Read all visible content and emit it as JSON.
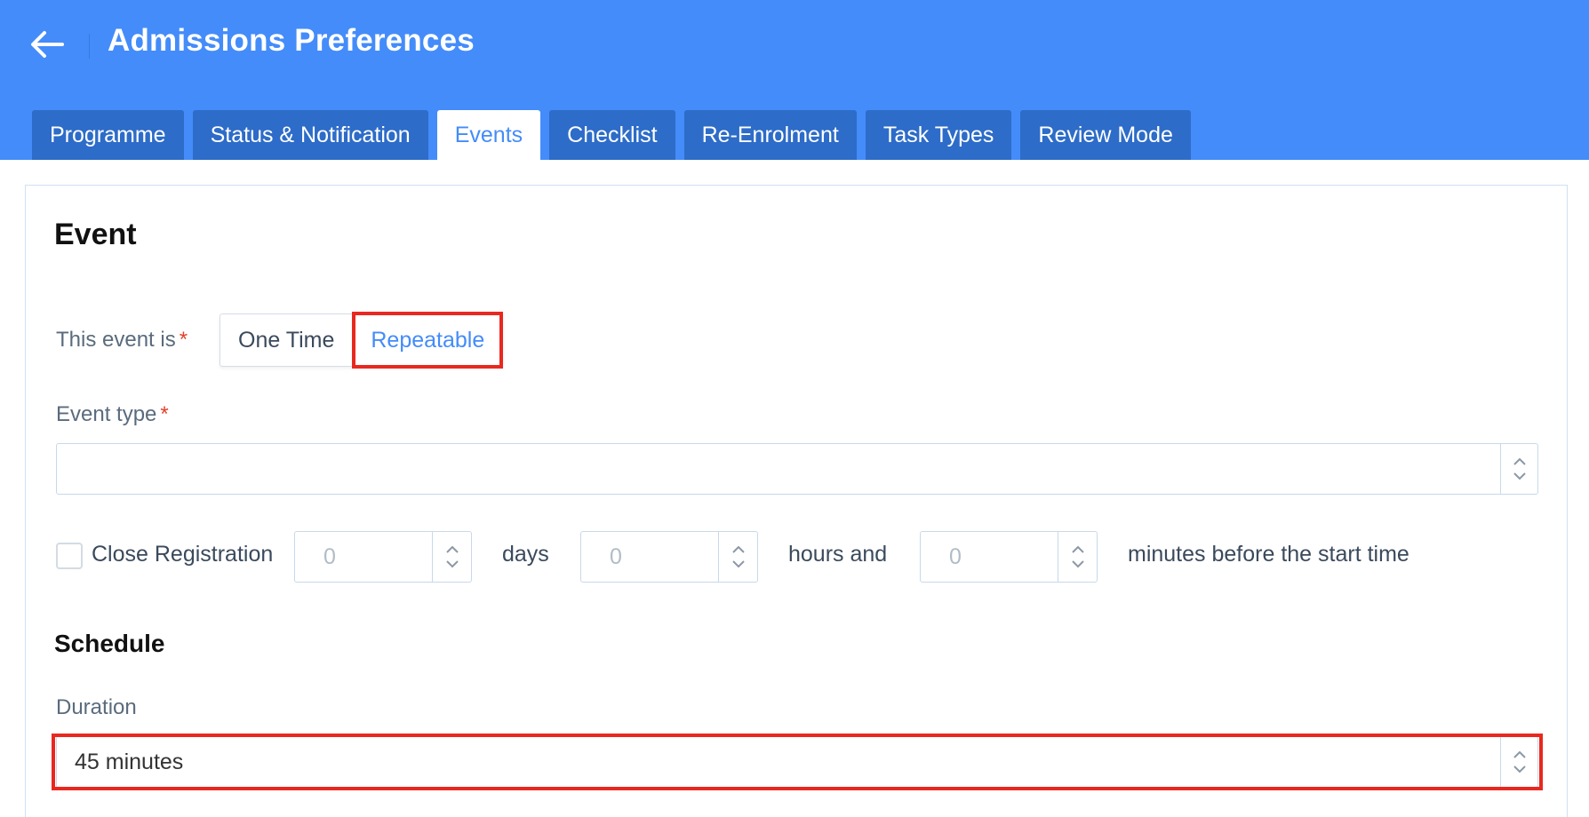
{
  "header": {
    "title": "Admissions Preferences",
    "back_icon": "arrow-left-icon",
    "color": "#448cf9"
  },
  "tabs": [
    {
      "label": "Programme",
      "active": false
    },
    {
      "label": "Status & Notification",
      "active": false
    },
    {
      "label": "Events",
      "active": true
    },
    {
      "label": "Checklist",
      "active": false
    },
    {
      "label": "Re-Enrolment",
      "active": false
    },
    {
      "label": "Task Types",
      "active": false
    },
    {
      "label": "Review Mode",
      "active": false
    }
  ],
  "event": {
    "title": "Event",
    "recurrence_label": "This event is",
    "required_mark": "*",
    "options": {
      "one_time": "One Time",
      "repeatable": "Repeatable"
    },
    "selected_option": "Repeatable",
    "event_type_label": "Event type",
    "event_type_value": ""
  },
  "close_registration": {
    "label": "Close Registration",
    "checked": false,
    "days_placeholder": "0",
    "days_label": "days",
    "hours_placeholder": "0",
    "hours_label": "hours and",
    "minutes_placeholder": "0",
    "minutes_label": "minutes before the start time"
  },
  "schedule": {
    "title": "Schedule",
    "duration_label": "Duration",
    "duration_value": "45 minutes"
  },
  "colors": {
    "accent": "#448cf9",
    "tab_inactive": "#2d6cc8",
    "highlight": "#e8281f",
    "required": "#e2412c"
  }
}
